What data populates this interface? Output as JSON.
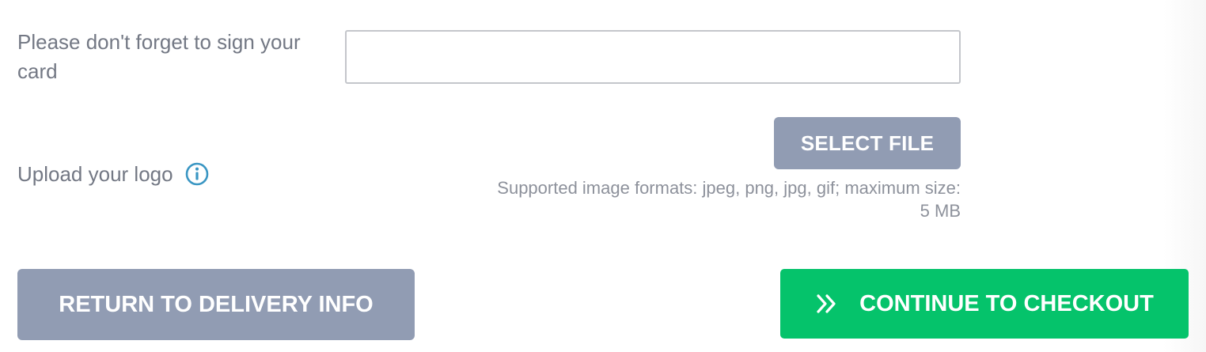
{
  "sign_card": {
    "label": "Please don't forget to sign your card",
    "value": "",
    "placeholder": ""
  },
  "upload_logo": {
    "label": "Upload your logo",
    "info_icon": "info-circle-icon",
    "select_file_label": "SELECT FILE",
    "formats_text": "Supported image formats: jpeg, png, jpg, gif; maximum size: 5 MB"
  },
  "actions": {
    "return_label": "RETURN TO DELIVERY INFO",
    "continue_label": "CONTINUE TO CHECKOUT",
    "continue_icon": "double-chevron-right-icon"
  },
  "colors": {
    "secondary_button": "#919cb3",
    "primary_button": "#05c36b",
    "info_icon": "#3a96c3",
    "label_text": "#737884"
  }
}
